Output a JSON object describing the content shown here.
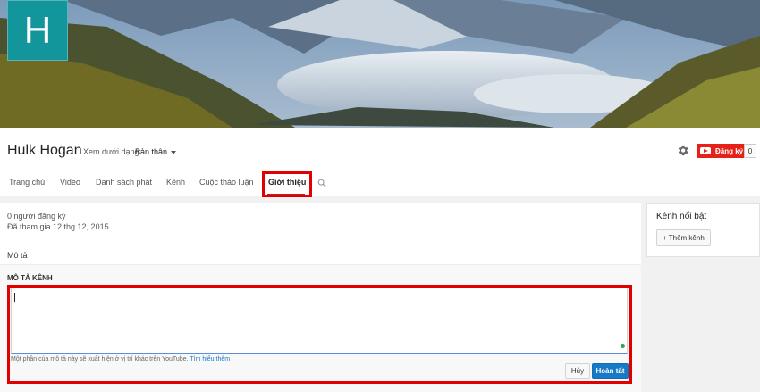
{
  "channel": {
    "avatar_letter": "H",
    "avatar_color": "#13959c",
    "name": "Hulk Hogan",
    "view_as_label": "Xem dưới dạng:",
    "view_as_value": "Bản thân",
    "subscribe_label": "Đăng ký",
    "subscriber_count": "0"
  },
  "tabs": [
    {
      "label": "Trang chủ"
    },
    {
      "label": "Video"
    },
    {
      "label": "Danh sách phát"
    },
    {
      "label": "Kênh"
    },
    {
      "label": "Cuộc thảo luận"
    },
    {
      "label": "Giới thiệu",
      "active": true
    }
  ],
  "about": {
    "subscribers_text": "0 người đăng ký",
    "joined_text": "Đã tham gia 12 thg 12, 2015",
    "description_label": "Mô tả",
    "description_heading": "MÔ TẢ KÊNH",
    "description_value": "",
    "hint_text": "Một phần của mô tả này sẽ xuất hiện ở vị trí khác trên YouTube.",
    "hint_link": "Tìm hiểu thêm",
    "cancel_label": "Hủy",
    "done_label": "Hoàn tất"
  },
  "sidebar": {
    "title": "Kênh nổi bật",
    "add_button_label": "+ Thêm kênh"
  },
  "icons": {
    "settings": "gear-icon",
    "search": "search-icon",
    "dropdown": "chevron-down-icon",
    "youtube": "youtube-play-icon"
  },
  "colors": {
    "accent_red": "#e62117",
    "link_blue": "#167ac6",
    "highlight_red": "#e00000"
  }
}
